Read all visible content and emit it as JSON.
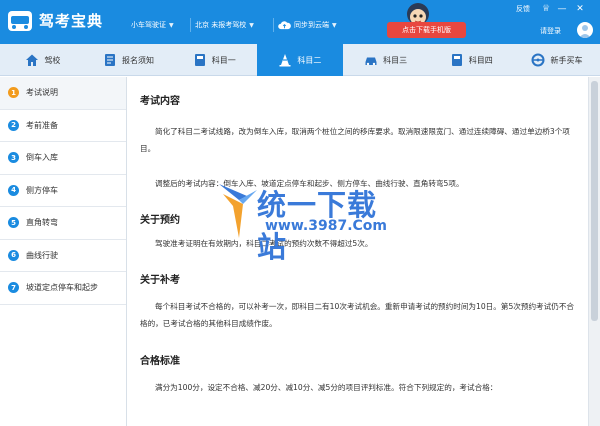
{
  "app": {
    "title": "驾考宝典"
  },
  "header": {
    "car_type": "小车驾驶证",
    "location": "北京 未报考驾校",
    "sync": "同步到云端",
    "download_btn": "点击下载手机版",
    "feedback": "反馈",
    "login": "请登录"
  },
  "nav": {
    "tabs": [
      {
        "label": "驾校",
        "icon": "home-icon"
      },
      {
        "label": "报名须知",
        "icon": "document-icon"
      },
      {
        "label": "科目一",
        "icon": "book-icon"
      },
      {
        "label": "科目二",
        "icon": "road-cone-icon",
        "active": true
      },
      {
        "label": "科目三",
        "icon": "car-icon"
      },
      {
        "label": "科目四",
        "icon": "book-icon"
      },
      {
        "label": "新手买车",
        "icon": "steering-wheel-icon"
      }
    ]
  },
  "sidebar": {
    "items": [
      {
        "num": "1",
        "label": "考试说明",
        "active": true
      },
      {
        "num": "2",
        "label": "考前准备"
      },
      {
        "num": "3",
        "label": "倒车入库"
      },
      {
        "num": "4",
        "label": "侧方停车"
      },
      {
        "num": "5",
        "label": "直角转弯"
      },
      {
        "num": "6",
        "label": "曲线行驶"
      },
      {
        "num": "7",
        "label": "坡道定点停车和起步"
      }
    ]
  },
  "content": {
    "s1_title": "考试内容",
    "s1_p1": "简化了科目二考试线路，改为倒车入库，取消两个桩位之间的移库要求。取消限速限宽门、通过连续障碍、通过单边桥3个项目。",
    "s1_p2": "调整后的考试内容：倒车入库、坡道定点停车和起步、侧方停车、曲线行驶、直角转弯5项。",
    "s2_title": "关于预约",
    "s2_p1": "驾驶准考证明在有效期内，科目二考试的预约次数不得超过5次。",
    "s3_title": "关于补考",
    "s3_p1": "每个科目考试不合格的，可以补考一次，即科目二有10次考试机会。重新申请考试的预约时间为10日。第5次预约考试仍不合格的，已考试合格的其他科目成绩作废。",
    "s4_title": "合格标准",
    "s4_p1": "满分为100分，设定不合格、减20分、减10分、减5分的项目评判标准。符合下列规定的，考试合格："
  },
  "watermark": {
    "text": "统一下载站",
    "url": "www.3987.Com"
  },
  "colors": {
    "primary": "#1a8be0",
    "accent": "#f29b1d",
    "download": "#e8473f"
  }
}
